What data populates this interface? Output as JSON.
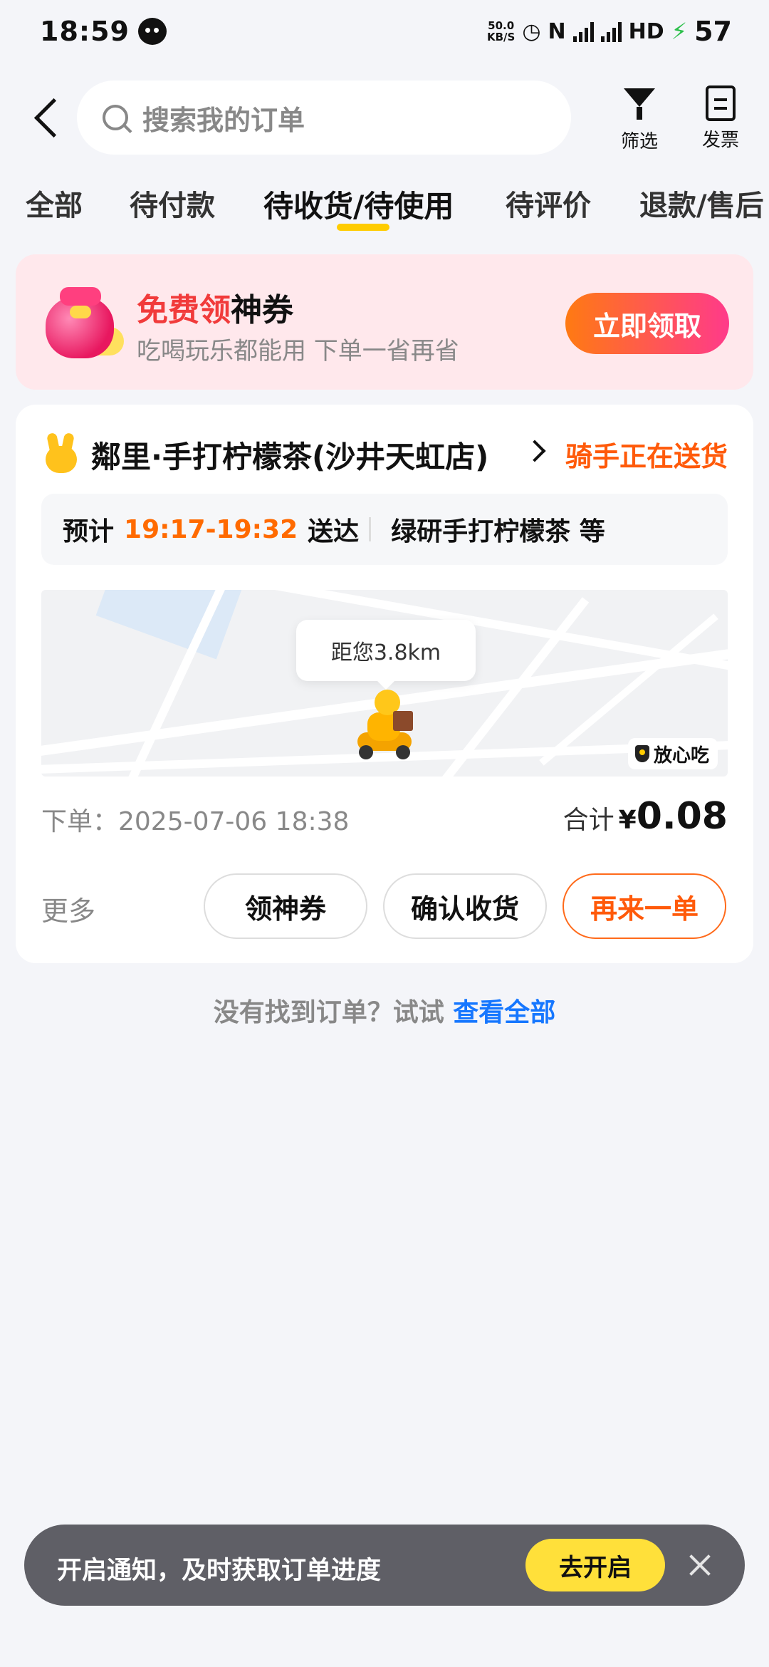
{
  "status_bar": {
    "time": "18:59",
    "net_speed_top": "50.0",
    "net_speed_bottom": "KB/S",
    "hd_label": "HD",
    "battery": "57",
    "icons": [
      "chat-icon",
      "alarm-icon",
      "nfc-icon",
      "signal-4g-icon",
      "signal-4g-icon",
      "charging-icon"
    ]
  },
  "header": {
    "search_placeholder": "搜索我的订单",
    "filter_label": "筛选",
    "invoice_label": "发票"
  },
  "tabs": [
    {
      "label": "全部",
      "active": false
    },
    {
      "label": "待付款",
      "active": false
    },
    {
      "label": "待收货/待使用",
      "active": true
    },
    {
      "label": "待评价",
      "active": false
    },
    {
      "label": "退款/售后",
      "active": false
    }
  ],
  "promo": {
    "title_red": "免费领",
    "title_black": "神券",
    "subtitle": "吃喝玩乐都能用 下单一省再省",
    "button": "立即领取"
  },
  "order": {
    "shop_name": "鄰里·手打柠檬茶(沙井天虹店)",
    "status": "骑手正在送货",
    "eta_prefix": "预计",
    "eta_time": "19:17-19:32",
    "eta_suffix": "送达",
    "items": "绿研手打柠檬茶 等",
    "distance": "距您3.8km",
    "badge": "放心吃",
    "order_time": "下单：2025-07-06 18:38",
    "total_label": "合计",
    "currency": "¥",
    "total_amount": "0.08",
    "more": "更多",
    "buttons": {
      "coupon": "领神券",
      "confirm": "确认收货",
      "again": "再来一单"
    }
  },
  "not_found": {
    "text": "没有找到订单？试试",
    "link": "查看全部"
  },
  "notify": {
    "text": "开启通知，及时获取订单进度",
    "button": "去开启"
  },
  "colors": {
    "accent_yellow": "#ffcc00",
    "orange": "#ff5a0a",
    "link_blue": "#1677ff",
    "promo_bg": "#ffe8ec"
  }
}
